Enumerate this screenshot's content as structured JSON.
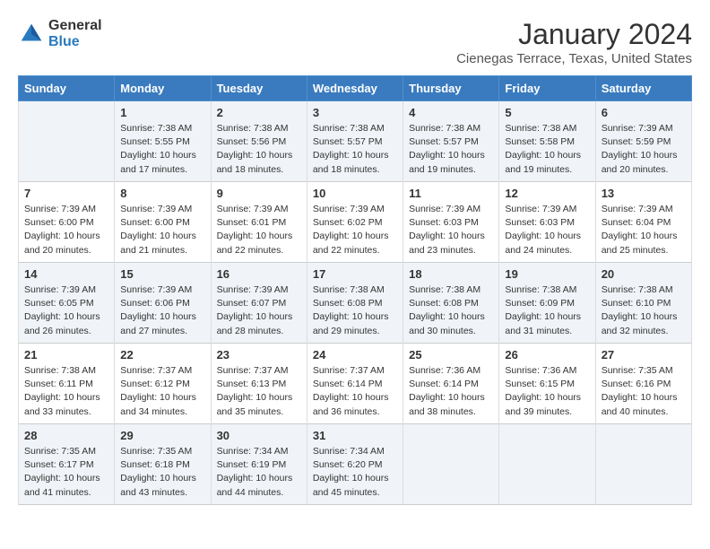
{
  "logo": {
    "general": "General",
    "blue": "Blue"
  },
  "title": "January 2024",
  "location": "Cienegas Terrace, Texas, United States",
  "days_header": [
    "Sunday",
    "Monday",
    "Tuesday",
    "Wednesday",
    "Thursday",
    "Friday",
    "Saturday"
  ],
  "weeks": [
    [
      {
        "day": "",
        "info": ""
      },
      {
        "day": "1",
        "info": "Sunrise: 7:38 AM\nSunset: 5:55 PM\nDaylight: 10 hours\nand 17 minutes."
      },
      {
        "day": "2",
        "info": "Sunrise: 7:38 AM\nSunset: 5:56 PM\nDaylight: 10 hours\nand 18 minutes."
      },
      {
        "day": "3",
        "info": "Sunrise: 7:38 AM\nSunset: 5:57 PM\nDaylight: 10 hours\nand 18 minutes."
      },
      {
        "day": "4",
        "info": "Sunrise: 7:38 AM\nSunset: 5:57 PM\nDaylight: 10 hours\nand 19 minutes."
      },
      {
        "day": "5",
        "info": "Sunrise: 7:38 AM\nSunset: 5:58 PM\nDaylight: 10 hours\nand 19 minutes."
      },
      {
        "day": "6",
        "info": "Sunrise: 7:39 AM\nSunset: 5:59 PM\nDaylight: 10 hours\nand 20 minutes."
      }
    ],
    [
      {
        "day": "7",
        "info": "Sunrise: 7:39 AM\nSunset: 6:00 PM\nDaylight: 10 hours\nand 20 minutes."
      },
      {
        "day": "8",
        "info": "Sunrise: 7:39 AM\nSunset: 6:00 PM\nDaylight: 10 hours\nand 21 minutes."
      },
      {
        "day": "9",
        "info": "Sunrise: 7:39 AM\nSunset: 6:01 PM\nDaylight: 10 hours\nand 22 minutes."
      },
      {
        "day": "10",
        "info": "Sunrise: 7:39 AM\nSunset: 6:02 PM\nDaylight: 10 hours\nand 22 minutes."
      },
      {
        "day": "11",
        "info": "Sunrise: 7:39 AM\nSunset: 6:03 PM\nDaylight: 10 hours\nand 23 minutes."
      },
      {
        "day": "12",
        "info": "Sunrise: 7:39 AM\nSunset: 6:03 PM\nDaylight: 10 hours\nand 24 minutes."
      },
      {
        "day": "13",
        "info": "Sunrise: 7:39 AM\nSunset: 6:04 PM\nDaylight: 10 hours\nand 25 minutes."
      }
    ],
    [
      {
        "day": "14",
        "info": "Sunrise: 7:39 AM\nSunset: 6:05 PM\nDaylight: 10 hours\nand 26 minutes."
      },
      {
        "day": "15",
        "info": "Sunrise: 7:39 AM\nSunset: 6:06 PM\nDaylight: 10 hours\nand 27 minutes."
      },
      {
        "day": "16",
        "info": "Sunrise: 7:39 AM\nSunset: 6:07 PM\nDaylight: 10 hours\nand 28 minutes."
      },
      {
        "day": "17",
        "info": "Sunrise: 7:38 AM\nSunset: 6:08 PM\nDaylight: 10 hours\nand 29 minutes."
      },
      {
        "day": "18",
        "info": "Sunrise: 7:38 AM\nSunset: 6:08 PM\nDaylight: 10 hours\nand 30 minutes."
      },
      {
        "day": "19",
        "info": "Sunrise: 7:38 AM\nSunset: 6:09 PM\nDaylight: 10 hours\nand 31 minutes."
      },
      {
        "day": "20",
        "info": "Sunrise: 7:38 AM\nSunset: 6:10 PM\nDaylight: 10 hours\nand 32 minutes."
      }
    ],
    [
      {
        "day": "21",
        "info": "Sunrise: 7:38 AM\nSunset: 6:11 PM\nDaylight: 10 hours\nand 33 minutes."
      },
      {
        "day": "22",
        "info": "Sunrise: 7:37 AM\nSunset: 6:12 PM\nDaylight: 10 hours\nand 34 minutes."
      },
      {
        "day": "23",
        "info": "Sunrise: 7:37 AM\nSunset: 6:13 PM\nDaylight: 10 hours\nand 35 minutes."
      },
      {
        "day": "24",
        "info": "Sunrise: 7:37 AM\nSunset: 6:14 PM\nDaylight: 10 hours\nand 36 minutes."
      },
      {
        "day": "25",
        "info": "Sunrise: 7:36 AM\nSunset: 6:14 PM\nDaylight: 10 hours\nand 38 minutes."
      },
      {
        "day": "26",
        "info": "Sunrise: 7:36 AM\nSunset: 6:15 PM\nDaylight: 10 hours\nand 39 minutes."
      },
      {
        "day": "27",
        "info": "Sunrise: 7:35 AM\nSunset: 6:16 PM\nDaylight: 10 hours\nand 40 minutes."
      }
    ],
    [
      {
        "day": "28",
        "info": "Sunrise: 7:35 AM\nSunset: 6:17 PM\nDaylight: 10 hours\nand 41 minutes."
      },
      {
        "day": "29",
        "info": "Sunrise: 7:35 AM\nSunset: 6:18 PM\nDaylight: 10 hours\nand 43 minutes."
      },
      {
        "day": "30",
        "info": "Sunrise: 7:34 AM\nSunset: 6:19 PM\nDaylight: 10 hours\nand 44 minutes."
      },
      {
        "day": "31",
        "info": "Sunrise: 7:34 AM\nSunset: 6:20 PM\nDaylight: 10 hours\nand 45 minutes."
      },
      {
        "day": "",
        "info": ""
      },
      {
        "day": "",
        "info": ""
      },
      {
        "day": "",
        "info": ""
      }
    ]
  ]
}
